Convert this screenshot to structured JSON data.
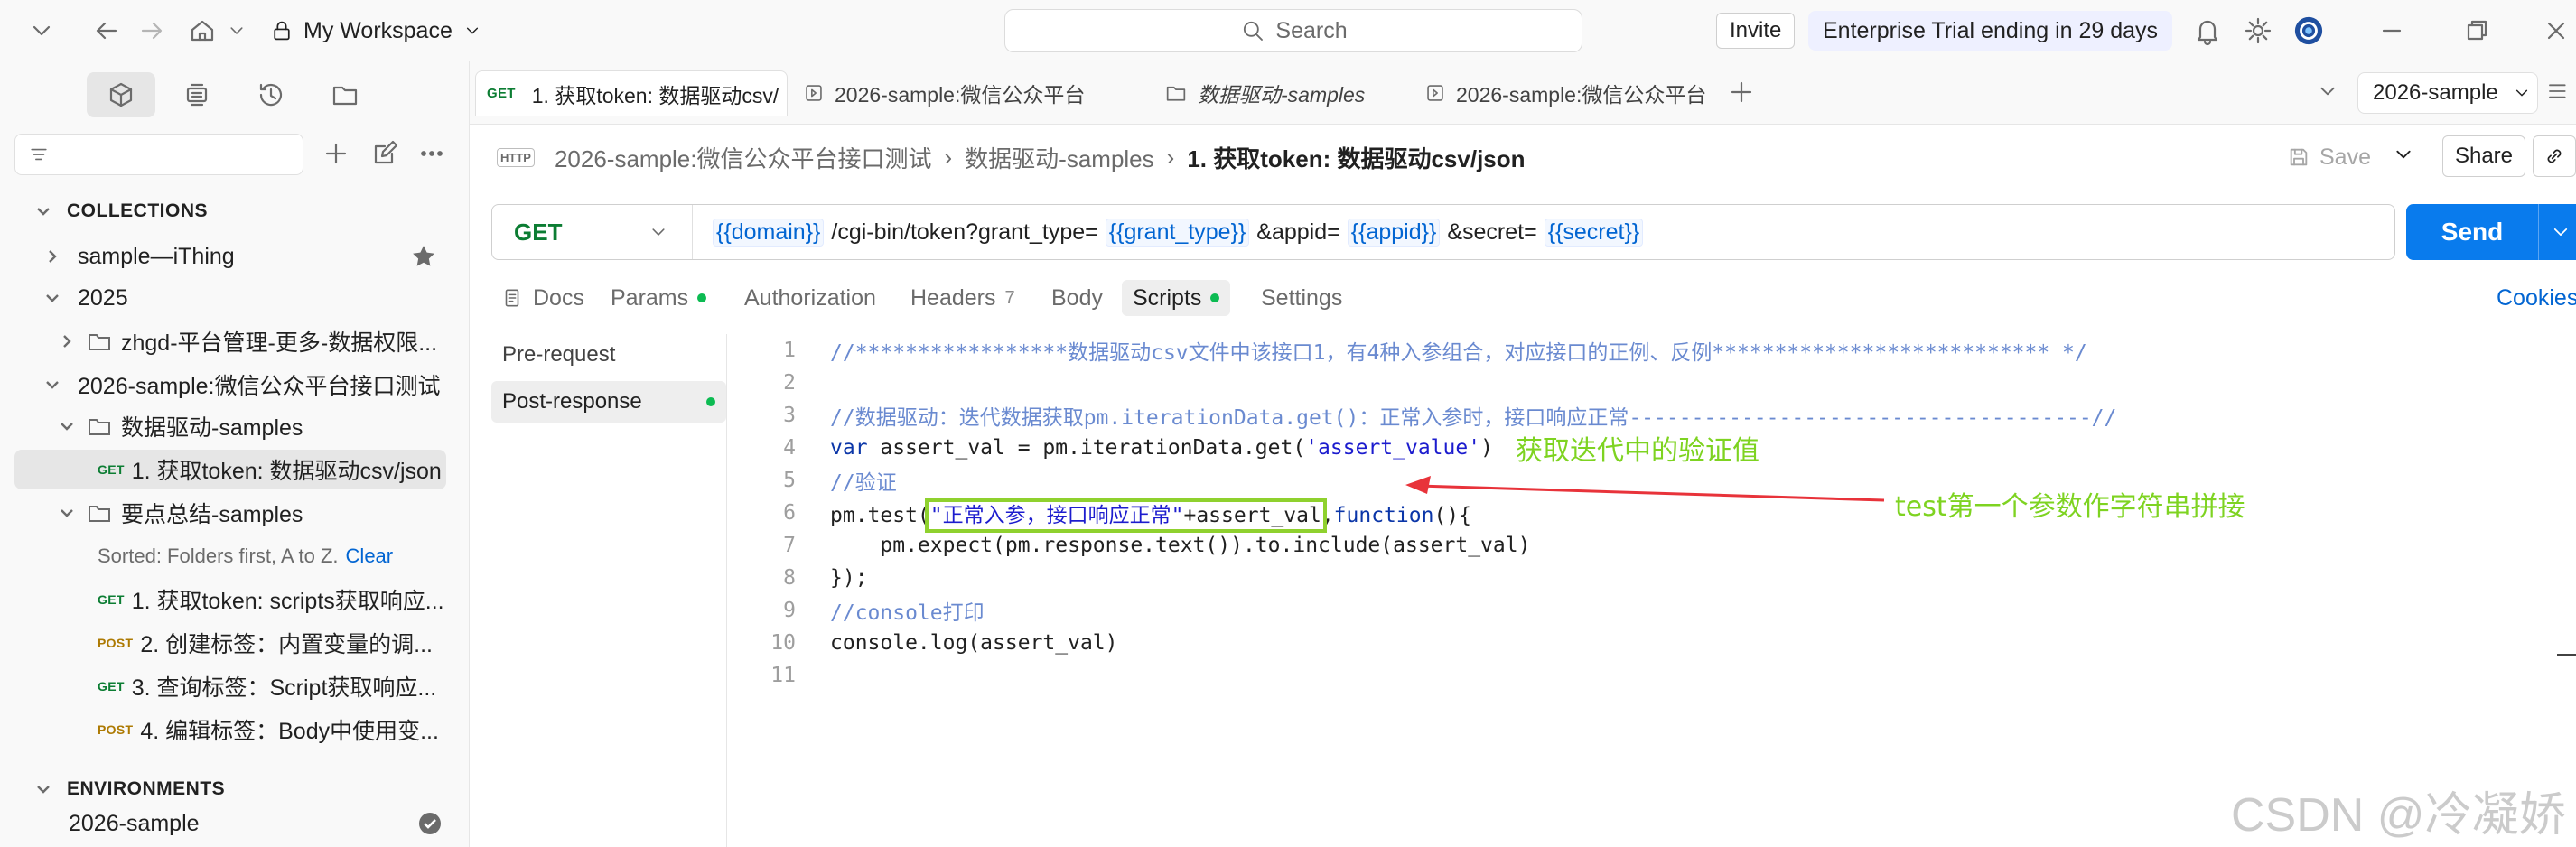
{
  "topbar": {
    "workspace": "My Workspace",
    "search_placeholder": "Search",
    "invite": "Invite",
    "trial": "Enterprise Trial ending in 29 days"
  },
  "sidebar": {
    "collections_head": "COLLECTIONS",
    "environments_head": "ENVIRONMENTS",
    "tree": [
      {
        "label": "sample—iThing"
      },
      {
        "label": "2025"
      },
      {
        "label": "zhgd-平台管理-更多-数据权限..."
      },
      {
        "label": "2026-sample:微信公众平台接口测试"
      },
      {
        "label": "数据驱动-samples"
      },
      {
        "method": "GET",
        "label": "1. 获取token: 数据驱动csv/json"
      },
      {
        "label": "要点总结-samples"
      },
      {
        "method": "GET",
        "label": "1. 获取token: scripts获取响应..."
      },
      {
        "method": "POST",
        "label": "2. 创建标签：内置变量的调..."
      },
      {
        "method": "GET",
        "label": "3. 查询标签：Script获取响应..."
      },
      {
        "method": "POST",
        "label": "4. 编辑标签：Body中使用变..."
      }
    ],
    "sorted_text": "Sorted: Folders first, A to Z.",
    "sorted_clear": "Clear",
    "environment": "2026-sample"
  },
  "tabs": [
    {
      "method": "GET",
      "label": "1. 获取token: 数据驱动csv/"
    },
    {
      "label": "2026-sample:微信公众平台"
    },
    {
      "label": "数据驱动-samples"
    },
    {
      "label": "2026-sample:微信公众平台"
    }
  ],
  "env_select": "2026-sample",
  "breadcrumb": {
    "badge": "HTTP",
    "items": [
      "2026-sample:微信公众平台接口测试",
      "数据驱动-samples",
      "1. 获取token: 数据驱动csv/json"
    ],
    "save": "Save",
    "share": "Share"
  },
  "request": {
    "method": "GET",
    "url_parts": [
      "{{domain}}",
      "/cgi-bin/token?grant_type=",
      "{{grant_type}}",
      "&appid=",
      "{{appid}}",
      "&secret=",
      "{{secret}}"
    ],
    "send": "Send"
  },
  "request_tabs": {
    "docs": "Docs",
    "params": "Params",
    "authorization": "Authorization",
    "headers": "Headers",
    "headers_count": "7",
    "body": "Body",
    "scripts": "Scripts",
    "settings": "Settings",
    "cookies": "Cookies"
  },
  "scripts": {
    "pre_request": "Pre-request",
    "post_response": "Post-response"
  },
  "code": {
    "line_numbers": [
      "1",
      "2",
      "3",
      "4",
      "5",
      "6",
      "7",
      "8",
      "9",
      "10",
      "11"
    ],
    "l1": "//*****************数据驱动csv文件中该接口1，有4种入参组合，对应接口的正例、反例*************************** */",
    "l3": "//数据驱动：迭代数据获取pm.iterationData.get()：正常入参时，接口响应正常-------------------------------------//",
    "l4_kw": "var",
    "l4_a": " assert_val = pm.iterationData.get(",
    "l4_str": "'assert_value'",
    "l4_b": ")",
    "l5": "//验证",
    "l6_a": "pm.test(",
    "l6_str": "\"正常入参，接口响应正常\"",
    "l6_b": "+assert_val",
    "l6_c": ",",
    "l6_kw": "function",
    "l6_d": "(){",
    "l7": "    pm.expect(pm.response.text()).to.include(assert_val)",
    "l8": "});",
    "l9": "//console打印",
    "l10": "console.log(assert_val)"
  },
  "annotations": {
    "note1": "获取迭代中的验证值",
    "note2": "test第一个参数作字符串拼接",
    "color": "#7ed321",
    "arrow_color": "#e8333a"
  },
  "watermark": "CSDN @冷凝娇"
}
